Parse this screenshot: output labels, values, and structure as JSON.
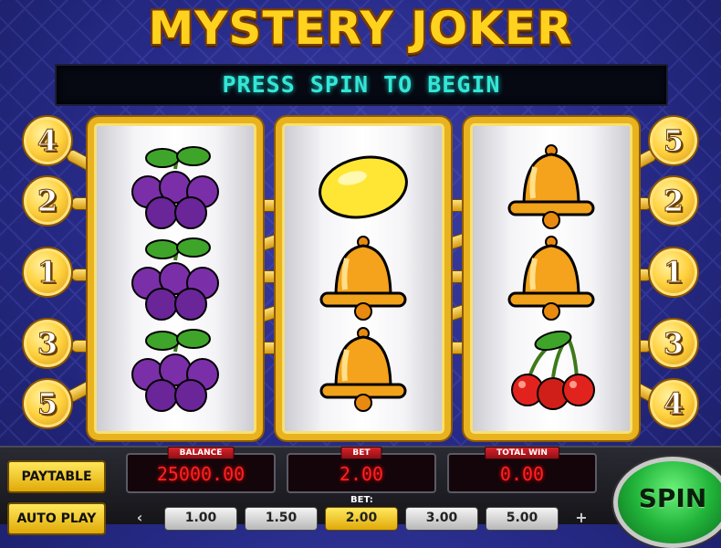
{
  "game": {
    "title": "MYSTERY JOKER",
    "message": "PRESS SPIN TO BEGIN"
  },
  "reels": [
    {
      "symbols": [
        "plum-icon",
        "plum-icon",
        "plum-icon"
      ]
    },
    {
      "symbols": [
        "lemon-icon",
        "bell-icon",
        "bell-icon"
      ]
    },
    {
      "symbols": [
        "bell-icon",
        "bell-icon",
        "cherry-icon"
      ]
    }
  ],
  "paylines": {
    "left": [
      "4",
      "2",
      "1",
      "3",
      "5"
    ],
    "right": [
      "5",
      "2",
      "1",
      "3",
      "4"
    ]
  },
  "buttons": {
    "paytable": "PAYTABLE",
    "autoplay": "AUTO PLAY",
    "spin": "SPIN"
  },
  "panels": {
    "balance": {
      "label": "BALANCE",
      "value": "25000.00"
    },
    "bet": {
      "label": "BET",
      "value": "2.00"
    },
    "total_win": {
      "label": "TOTAL WIN",
      "value": "0.00"
    }
  },
  "bet_selector": {
    "label": "BET:",
    "options": [
      "1.00",
      "1.50",
      "2.00",
      "3.00",
      "5.00"
    ],
    "selected": "2.00",
    "prev": "‹",
    "next": "+"
  },
  "colors": {
    "accent_gold": "#e9b21f",
    "led_red": "#ff2323",
    "message_cyan": "#34e6d6",
    "spin_green": "#21b43a"
  }
}
